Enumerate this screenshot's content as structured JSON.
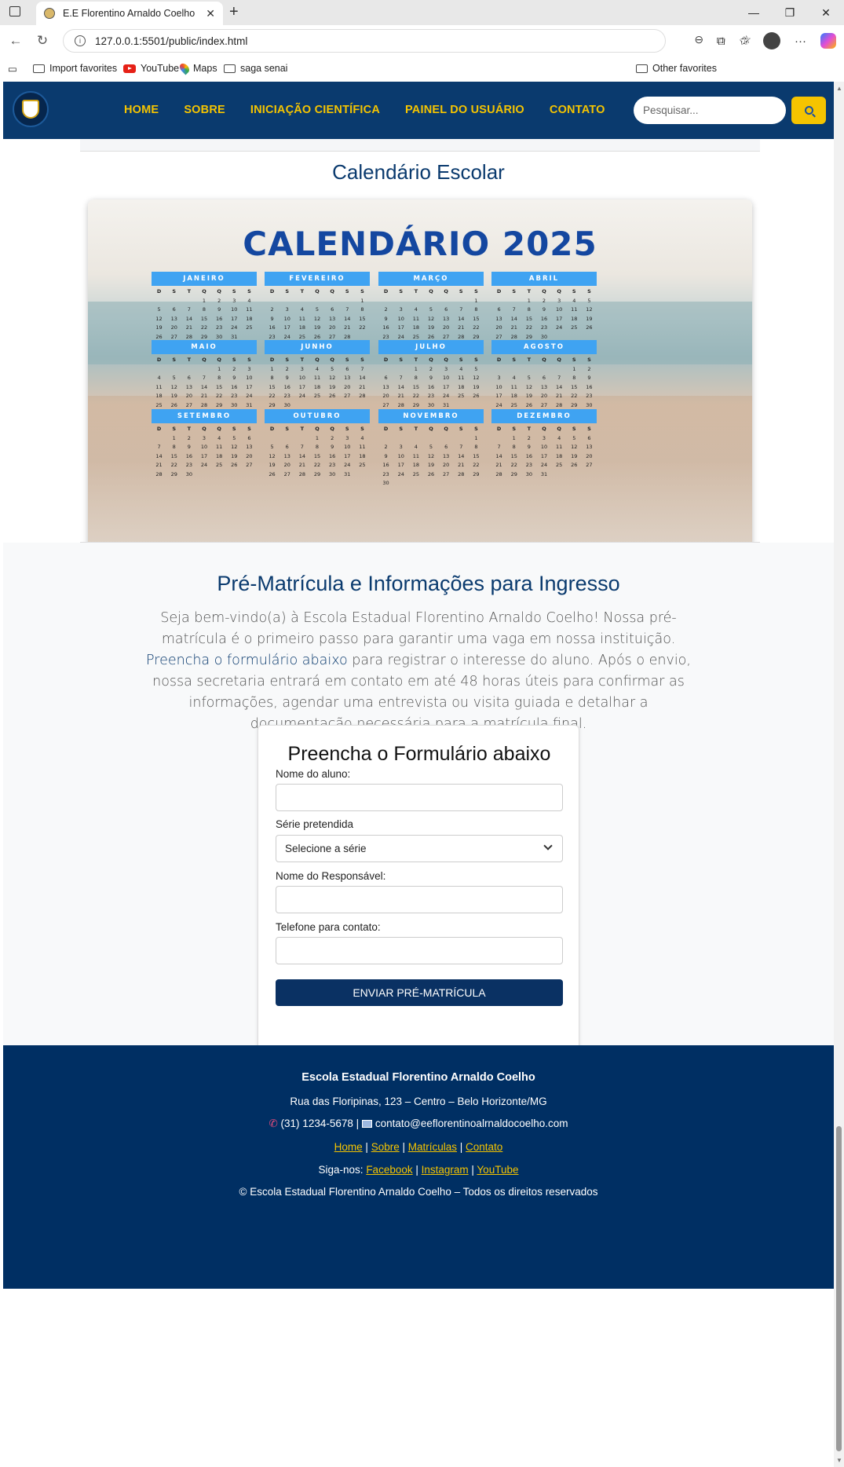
{
  "browser": {
    "tab_title": "E.E Florentino Arnaldo Coelho",
    "url": "127.0.0.1:5501/public/index.html",
    "favorites": [
      "Import favorites",
      "YouTube",
      "Maps",
      "saga senai"
    ],
    "other_favorites": "Other favorites"
  },
  "nav": {
    "items": [
      "HOME",
      "SOBRE",
      "INICIAÇÃO CIENTÍFICA",
      "PAINEL DO USUÁRIO",
      "CONTATO"
    ],
    "search_placeholder": "Pesquisar..."
  },
  "calendar_section": {
    "title": "Calendário Escolar",
    "image_title": "CALENDÁRIO 2025",
    "weekdays": [
      "D",
      "S",
      "T",
      "Q",
      "Q",
      "S",
      "S"
    ],
    "months": [
      {
        "name": "JANEIRO",
        "offset": 3,
        "days": 31
      },
      {
        "name": "FEVEREIRO",
        "offset": 6,
        "days": 28
      },
      {
        "name": "MARÇO",
        "offset": 6,
        "days": 31
      },
      {
        "name": "ABRIL",
        "offset": 2,
        "days": 30
      },
      {
        "name": "MAIO",
        "offset": 4,
        "days": 31
      },
      {
        "name": "JUNHO",
        "offset": 0,
        "days": 30
      },
      {
        "name": "JULHO",
        "offset": 2,
        "days": 31
      },
      {
        "name": "AGOSTO",
        "offset": 5,
        "days": 31
      },
      {
        "name": "SETEMBRO",
        "offset": 1,
        "days": 30
      },
      {
        "name": "OUTUBRO",
        "offset": 3,
        "days": 31
      },
      {
        "name": "NOVEMBRO",
        "offset": 6,
        "days": 30
      },
      {
        "name": "DEZEMBRO",
        "offset": 1,
        "days": 31
      }
    ]
  },
  "enrollment": {
    "title": "Pré-Matrícula e Informações para Ingresso",
    "intro_before": "Seja bem-vindo(a) à Escola Estadual Florentino Arnaldo Coelho! Nossa pré-matrícula é o primeiro passo para garantir uma vaga em nossa instituição. ",
    "intro_highlight": "Preencha o formulário abaixo",
    "intro_after": " para registrar o interesse do aluno. Após o envio, nossa secretaria entrará em contato em até 48 horas úteis para confirmar as informações, agendar uma entrevista ou visita guiada e detalhar a documentação necessária para a matrícula final."
  },
  "form": {
    "title": "Preencha o Formulário abaixo",
    "student_label": "Nome do aluno:",
    "student_value": "",
    "grade_label": "Série pretendida",
    "grade_selected": "Selecione a série",
    "guardian_label": "Nome do Responsável:",
    "guardian_value": "",
    "phone_label": "Telefone para contato:",
    "phone_value": "",
    "submit_label": "ENVIAR PRÉ-MATRÍCULA"
  },
  "footer": {
    "school_name": "Escola Estadual Florentino Arnaldo Coelho",
    "address": "Rua das Floripinas, 123 – Centro – Belo Horizonte/MG",
    "phone": "(31) 1234-5678",
    "email": "contato@eeflorentinoalrnaldocoelho.com",
    "links": [
      "Home",
      "Sobre",
      "Matrículas",
      "Contato"
    ],
    "follow_label": "Siga-nos:",
    "social": [
      "Facebook",
      "Instagram",
      "YouTube"
    ],
    "copyright": "© Escola Estadual Florentino Arnaldo Coelho – Todos os direitos reservados"
  },
  "colors": {
    "primary": "#0a3a6e",
    "accent": "#f5c400",
    "footer_bg": "#002f63",
    "month_header": "#3fa3f2"
  }
}
